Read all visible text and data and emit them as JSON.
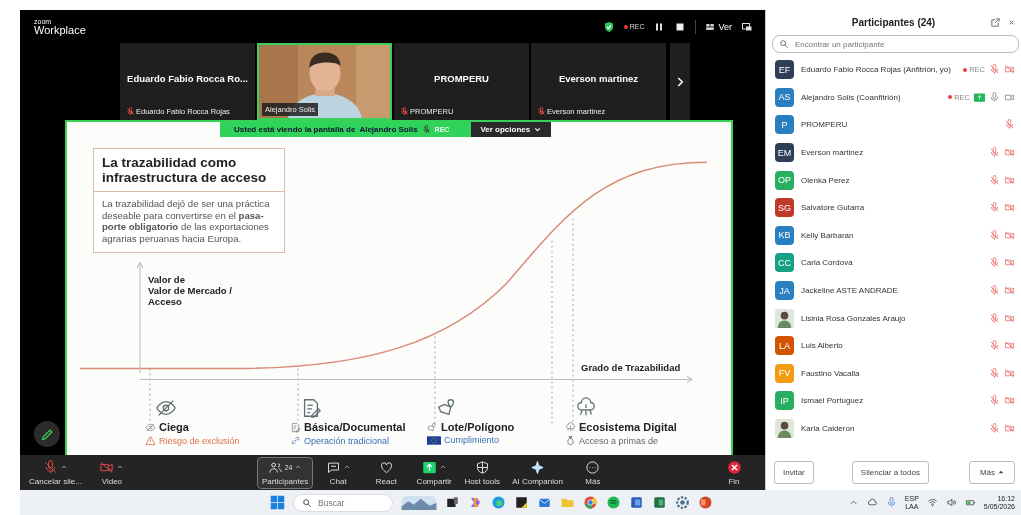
{
  "app": {
    "logo_small": "zoom",
    "logo": "Workplace",
    "rec": "REC",
    "view": "Ver"
  },
  "videos": [
    {
      "kind": "name",
      "name": "Eduardo Fabio Rocca Ro...",
      "label": "Eduardo Fabio Rocca Rojas",
      "muted": true,
      "active": false
    },
    {
      "kind": "video",
      "label": "Alejandro Solis",
      "muted": false,
      "active": true
    },
    {
      "kind": "name",
      "name": "PROMPERU",
      "label": "PROMPERU",
      "muted": true,
      "active": false
    },
    {
      "kind": "name",
      "name": "Everson martinez",
      "label": "Everson martinez",
      "muted": true,
      "active": false
    }
  ],
  "share_banner": {
    "text": "Usted está viendo la pantalla de",
    "presenter": "Alejandro Solis",
    "rec": "REC",
    "options": "Ver opciones"
  },
  "slide": {
    "title": "La trazabilidad como infraestructura de acceso",
    "body": "La trazabilidad dejó de ser una práctica deseable para convertirse en el **pasa-porte obligatorio** de las exportaciones agrarias peruanas hacia Europa.",
    "y_label": "Valor de\nValor de Mercado /\nAcceso",
    "x_label": "Grado de Trazabilidad",
    "stages": [
      {
        "kind": "eye",
        "title": "Ciega",
        "note": "Riesgo de exclusión"
      },
      {
        "kind": "document",
        "title": "Básica/Documental",
        "note": "Operación tradicional"
      },
      {
        "kind": "map",
        "title": "Lote/Polígono",
        "note": "Cumplimiento"
      },
      {
        "kind": "cloud",
        "title": "Ecosistema Digital",
        "note": "Acceso a primas de"
      }
    ]
  },
  "toolbar": [
    {
      "kind": "mic",
      "label": "Cancelar sile...",
      "caret": true,
      "selected": false
    },
    {
      "kind": "video",
      "label": "Video",
      "caret": true,
      "selected": false
    },
    {
      "kind": "participants",
      "label": "Participantes",
      "count": "24",
      "caret": true,
      "selected": true
    },
    {
      "kind": "chat",
      "label": "Chat",
      "caret": true,
      "selected": false
    },
    {
      "kind": "react",
      "label": "React",
      "caret": false,
      "selected": false
    },
    {
      "kind": "share",
      "label": "Compartir",
      "caret": true,
      "selected": false
    },
    {
      "kind": "host",
      "label": "Host tools",
      "caret": false,
      "selected": false
    },
    {
      "kind": "ai",
      "label": "AI Companion",
      "caret": false,
      "selected": false
    },
    {
      "kind": "more",
      "label": "Más",
      "caret": false,
      "selected": false
    },
    {
      "kind": "end",
      "label": "Fin",
      "caret": false,
      "selected": false
    }
  ],
  "participants": {
    "title": "Participantes (24)",
    "search": {
      "placeholder": "Encontrar un participante"
    },
    "rows": [
      {
        "kind": "initials",
        "initials": "EF",
        "color": "#2e4057",
        "name": "Eduardo Fabio Rocca Rojas (Anfitrión, yo)",
        "badge": "REC",
        "sharing": false,
        "muted": true,
        "camera_on": false
      },
      {
        "kind": "initials",
        "initials": "AS",
        "color": "#2a7fc1",
        "name": "Alejandro Solis (Coanfitrión)",
        "badge": "REC",
        "sharing": true,
        "muted": false,
        "camera_on": true
      },
      {
        "kind": "initials",
        "initials": "P",
        "color": "#2a7fc1",
        "name": "PROMPERU",
        "sharing": false,
        "muted": true
      },
      {
        "kind": "initials",
        "initials": "EM",
        "color": "#2e4057",
        "name": "Everson martinez",
        "sharing": false,
        "muted": true,
        "camera_on": false
      },
      {
        "kind": "initials",
        "initials": "OP",
        "color": "#27ae60",
        "name": "Olenka Perez",
        "sharing": false,
        "muted": true,
        "camera_on": false
      },
      {
        "kind": "initials",
        "initials": "SG",
        "color": "#c0392b",
        "name": "Salvatore Gutarra",
        "sharing": false,
        "muted": true,
        "camera_on": false
      },
      {
        "kind": "initials",
        "initials": "KB",
        "color": "#2a7fc1",
        "name": "Kelly Barbaran",
        "sharing": false,
        "muted": true,
        "camera_on": false
      },
      {
        "kind": "initials",
        "initials": "CC",
        "color": "#16a085",
        "name": "Carla Cordova",
        "sharing": false,
        "muted": true,
        "camera_on": false
      },
      {
        "kind": "initials",
        "initials": "JA",
        "color": "#2a7fc1",
        "name": "Jackeline ASTE ANDRADE",
        "sharing": false,
        "muted": true,
        "camera_on": false
      },
      {
        "name": "Lisinia Rosa Gonzales Araujo",
        "sharing": false,
        "muted": true,
        "camera_on": false
      },
      {
        "kind": "initials",
        "initials": "LA",
        "color": "#d35400",
        "name": "Luis Alberto",
        "sharing": false,
        "muted": true,
        "camera_on": false
      },
      {
        "kind": "initials",
        "initials": "FV",
        "color": "#f39c12",
        "name": "Faustino Vacalla",
        "sharing": false,
        "muted": true,
        "camera_on": false
      },
      {
        "kind": "initials",
        "initials": "IP",
        "color": "#27ae60",
        "name": "Ismael Portuguez",
        "sharing": false,
        "muted": true,
        "camera_on": false
      },
      {
        "name": "Karla Calderon",
        "sharing": false,
        "muted": true,
        "camera_on": false
      }
    ],
    "buttons": [
      {
        "kind": "plain",
        "label": "Invitar"
      },
      {
        "kind": "plain",
        "label": "Silenciar a todos"
      },
      {
        "kind": "menu",
        "label": "Más"
      }
    ]
  },
  "taskbar": {
    "search": {
      "placeholder": "Buscar"
    },
    "language": "ESP",
    "layout": "LAA",
    "time": "16:12",
    "date": "5/05/2026"
  }
}
